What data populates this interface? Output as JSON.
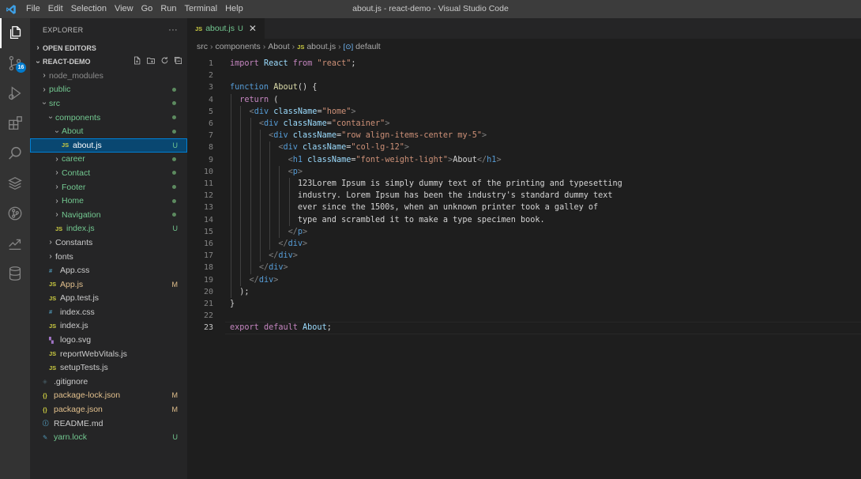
{
  "window": {
    "title": "about.js - react-demo - Visual Studio Code"
  },
  "menu": [
    "File",
    "Edit",
    "Selection",
    "View",
    "Go",
    "Run",
    "Terminal",
    "Help"
  ],
  "activity": {
    "scm_badge": "16"
  },
  "explorer": {
    "header": "EXPLORER",
    "more": "···",
    "open_editors": "OPEN EDITORS",
    "project": "REACT-DEMO",
    "tree": [
      {
        "label": "node_modules",
        "type": "folder",
        "open": false,
        "depth": 1,
        "color": "gray"
      },
      {
        "label": "public",
        "type": "folder",
        "open": false,
        "depth": 1,
        "color": "green",
        "mark": "dot"
      },
      {
        "label": "src",
        "type": "folder",
        "open": true,
        "depth": 1,
        "color": "green",
        "mark": "dot"
      },
      {
        "label": "components",
        "type": "folder",
        "open": true,
        "depth": 2,
        "color": "green",
        "mark": "dot"
      },
      {
        "label": "About",
        "type": "folder",
        "open": true,
        "depth": 3,
        "color": "green",
        "mark": "dot"
      },
      {
        "label": "about.js",
        "type": "js",
        "depth": 4,
        "color": "green",
        "mark": "U",
        "selected": true
      },
      {
        "label": "career",
        "type": "folder",
        "open": false,
        "depth": 3,
        "color": "green",
        "mark": "dot"
      },
      {
        "label": "Contact",
        "type": "folder",
        "open": false,
        "depth": 3,
        "color": "green",
        "mark": "dot"
      },
      {
        "label": "Footer",
        "type": "folder",
        "open": false,
        "depth": 3,
        "color": "green",
        "mark": "dot"
      },
      {
        "label": "Home",
        "type": "folder",
        "open": false,
        "depth": 3,
        "color": "green",
        "mark": "dot"
      },
      {
        "label": "Navigation",
        "type": "folder",
        "open": false,
        "depth": 3,
        "color": "green",
        "mark": "dot"
      },
      {
        "label": "index.js",
        "type": "js",
        "depth": 3,
        "color": "green",
        "mark": "U"
      },
      {
        "label": "Constants",
        "type": "folder",
        "open": false,
        "depth": 2,
        "color": "default"
      },
      {
        "label": "fonts",
        "type": "folder",
        "open": false,
        "depth": 2,
        "color": "default"
      },
      {
        "label": "App.css",
        "type": "css",
        "depth": 2,
        "color": "default"
      },
      {
        "label": "App.js",
        "type": "js",
        "depth": 2,
        "color": "mod",
        "mark": "M"
      },
      {
        "label": "App.test.js",
        "type": "js",
        "depth": 2,
        "color": "default"
      },
      {
        "label": "index.css",
        "type": "css",
        "depth": 2,
        "color": "default"
      },
      {
        "label": "index.js",
        "type": "js",
        "depth": 2,
        "color": "default"
      },
      {
        "label": "logo.svg",
        "type": "svg",
        "depth": 2,
        "color": "default"
      },
      {
        "label": "reportWebVitals.js",
        "type": "js",
        "depth": 2,
        "color": "default"
      },
      {
        "label": "setupTests.js",
        "type": "js",
        "depth": 2,
        "color": "default"
      },
      {
        "label": ".gitignore",
        "type": "git",
        "depth": 1,
        "color": "default"
      },
      {
        "label": "package-lock.json",
        "type": "json",
        "depth": 1,
        "color": "mod",
        "mark": "M"
      },
      {
        "label": "package.json",
        "type": "json",
        "depth": 1,
        "color": "mod",
        "mark": "M"
      },
      {
        "label": "README.md",
        "type": "info",
        "depth": 1,
        "color": "default"
      },
      {
        "label": "yarn.lock",
        "type": "yarn",
        "depth": 1,
        "color": "green",
        "mark": "U"
      }
    ]
  },
  "tab": {
    "label": "about.js",
    "status": "U",
    "close": "✕",
    "icon": "JS"
  },
  "breadcrumb": {
    "p1": "src",
    "p2": "components",
    "p3": "About",
    "p4": "about.js",
    "p5": "default"
  },
  "editor": {
    "current_line": 23,
    "lines": [
      [
        [
          "import",
          "kw"
        ],
        [
          " React ",
          "var"
        ],
        [
          "from",
          "kw"
        ],
        [
          " ",
          ""
        ],
        [
          "\"react\"",
          "str"
        ],
        [
          ";",
          ""
        ]
      ],
      [],
      [
        [
          "function",
          "decl"
        ],
        [
          " ",
          ""
        ],
        [
          "About",
          "fn"
        ],
        [
          "() {",
          ""
        ]
      ],
      [
        [
          "  ",
          ""
        ],
        [
          "return",
          "kw"
        ],
        [
          " (",
          ""
        ]
      ],
      [
        [
          "    ",
          ""
        ],
        [
          "<",
          "br"
        ],
        [
          "div",
          "tag"
        ],
        [
          " ",
          ""
        ],
        [
          "className",
          "attr"
        ],
        [
          "=",
          ""
        ],
        [
          "\"home\"",
          "str"
        ],
        [
          ">",
          "br"
        ]
      ],
      [
        [
          "      ",
          ""
        ],
        [
          "<",
          "br"
        ],
        [
          "div",
          "tag"
        ],
        [
          " ",
          ""
        ],
        [
          "className",
          "attr"
        ],
        [
          "=",
          ""
        ],
        [
          "\"container\"",
          "str"
        ],
        [
          ">",
          "br"
        ]
      ],
      [
        [
          "        ",
          ""
        ],
        [
          "<",
          "br"
        ],
        [
          "div",
          "tag"
        ],
        [
          " ",
          ""
        ],
        [
          "className",
          "attr"
        ],
        [
          "=",
          ""
        ],
        [
          "\"row align-items-center my-5\"",
          "str"
        ],
        [
          ">",
          "br"
        ]
      ],
      [
        [
          "          ",
          ""
        ],
        [
          "<",
          "br"
        ],
        [
          "div",
          "tag"
        ],
        [
          " ",
          ""
        ],
        [
          "className",
          "attr"
        ],
        [
          "=",
          ""
        ],
        [
          "\"col-lg-12\"",
          "str"
        ],
        [
          ">",
          "br"
        ]
      ],
      [
        [
          "            ",
          ""
        ],
        [
          "<",
          "br"
        ],
        [
          "h1",
          "tag"
        ],
        [
          " ",
          ""
        ],
        [
          "className",
          "attr"
        ],
        [
          "=",
          ""
        ],
        [
          "\"font-weight-light\"",
          "str"
        ],
        [
          ">",
          "br"
        ],
        [
          "About",
          ""
        ],
        [
          "</",
          "br"
        ],
        [
          "h1",
          "tag"
        ],
        [
          ">",
          "br"
        ]
      ],
      [
        [
          "            ",
          ""
        ],
        [
          "<",
          "br"
        ],
        [
          "p",
          "tag"
        ],
        [
          ">",
          "br"
        ]
      ],
      [
        [
          "              123Lorem Ipsum is simply dummy text of the printing and typesetting",
          ""
        ]
      ],
      [
        [
          "              industry. Lorem Ipsum has been the industry's standard dummy text",
          ""
        ]
      ],
      [
        [
          "              ever since the 1500s, when an unknown printer took a galley of",
          ""
        ]
      ],
      [
        [
          "              type and scrambled it to make a type specimen book.",
          ""
        ]
      ],
      [
        [
          "            ",
          ""
        ],
        [
          "</",
          "br"
        ],
        [
          "p",
          "tag"
        ],
        [
          ">",
          "br"
        ]
      ],
      [
        [
          "          ",
          ""
        ],
        [
          "</",
          "br"
        ],
        [
          "div",
          "tag"
        ],
        [
          ">",
          "br"
        ]
      ],
      [
        [
          "        ",
          ""
        ],
        [
          "</",
          "br"
        ],
        [
          "div",
          "tag"
        ],
        [
          ">",
          "br"
        ]
      ],
      [
        [
          "      ",
          ""
        ],
        [
          "</",
          "br"
        ],
        [
          "div",
          "tag"
        ],
        [
          ">",
          "br"
        ]
      ],
      [
        [
          "    ",
          ""
        ],
        [
          "</",
          "br"
        ],
        [
          "div",
          "tag"
        ],
        [
          ">",
          "br"
        ]
      ],
      [
        [
          "  );",
          ""
        ]
      ],
      [
        [
          "}",
          ""
        ]
      ],
      [],
      [
        [
          "export",
          "kw"
        ],
        [
          " ",
          ""
        ],
        [
          "default",
          "kw"
        ],
        [
          " ",
          ""
        ],
        [
          "About",
          "var"
        ],
        [
          ";",
          ""
        ]
      ]
    ]
  }
}
